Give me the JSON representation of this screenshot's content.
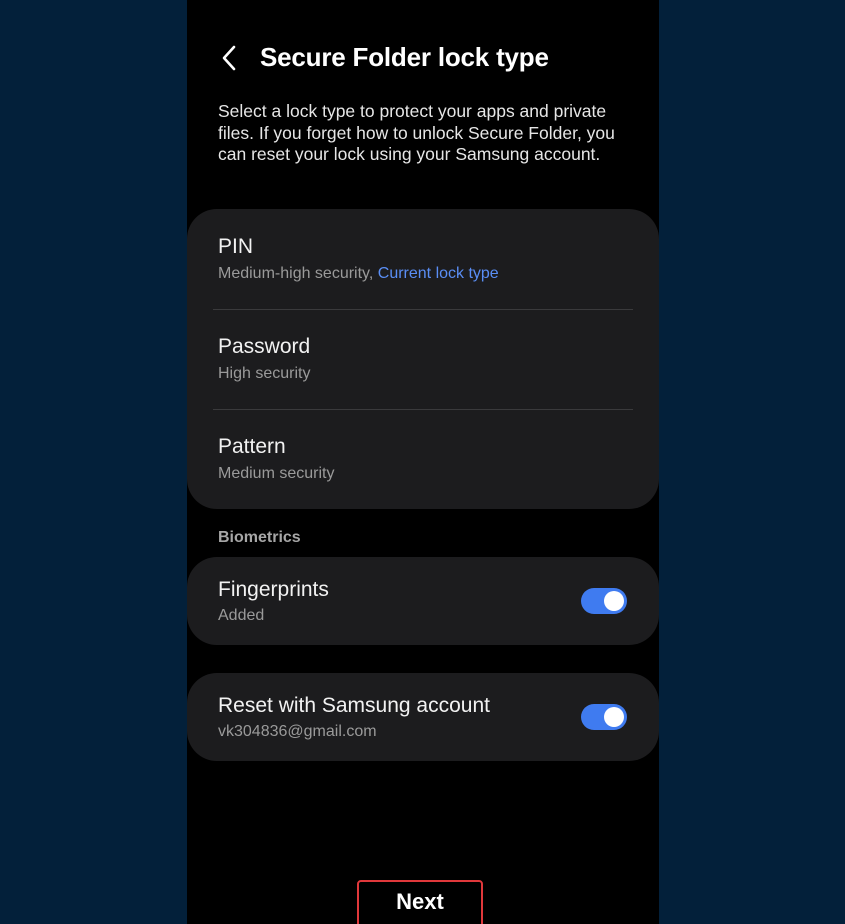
{
  "header": {
    "back_icon": "chevron-left-icon",
    "title": "Secure Folder lock type"
  },
  "description": "Select a lock type to protect your apps and private files. If you forget how to unlock Secure Folder, you can reset your lock using your Samsung account.",
  "lock_types": [
    {
      "title": "PIN",
      "subtitle": "Medium-high security, ",
      "current_label": "Current lock type"
    },
    {
      "title": "Password",
      "subtitle": "High security"
    },
    {
      "title": "Pattern",
      "subtitle": "Medium security"
    }
  ],
  "biometrics": {
    "section_label": "Biometrics",
    "fingerprints": {
      "title": "Fingerprints",
      "subtitle": "Added",
      "enabled": true
    }
  },
  "reset": {
    "title": "Reset with Samsung account",
    "subtitle": "vk304836@gmail.com",
    "enabled": true
  },
  "next_label": "Next",
  "colors": {
    "background": "#03203a",
    "screen": "#000000",
    "card": "#1c1c1e",
    "accent_link": "#5a8ef5",
    "switch_on": "#3f7bf0",
    "highlight_border": "#e0383b"
  }
}
